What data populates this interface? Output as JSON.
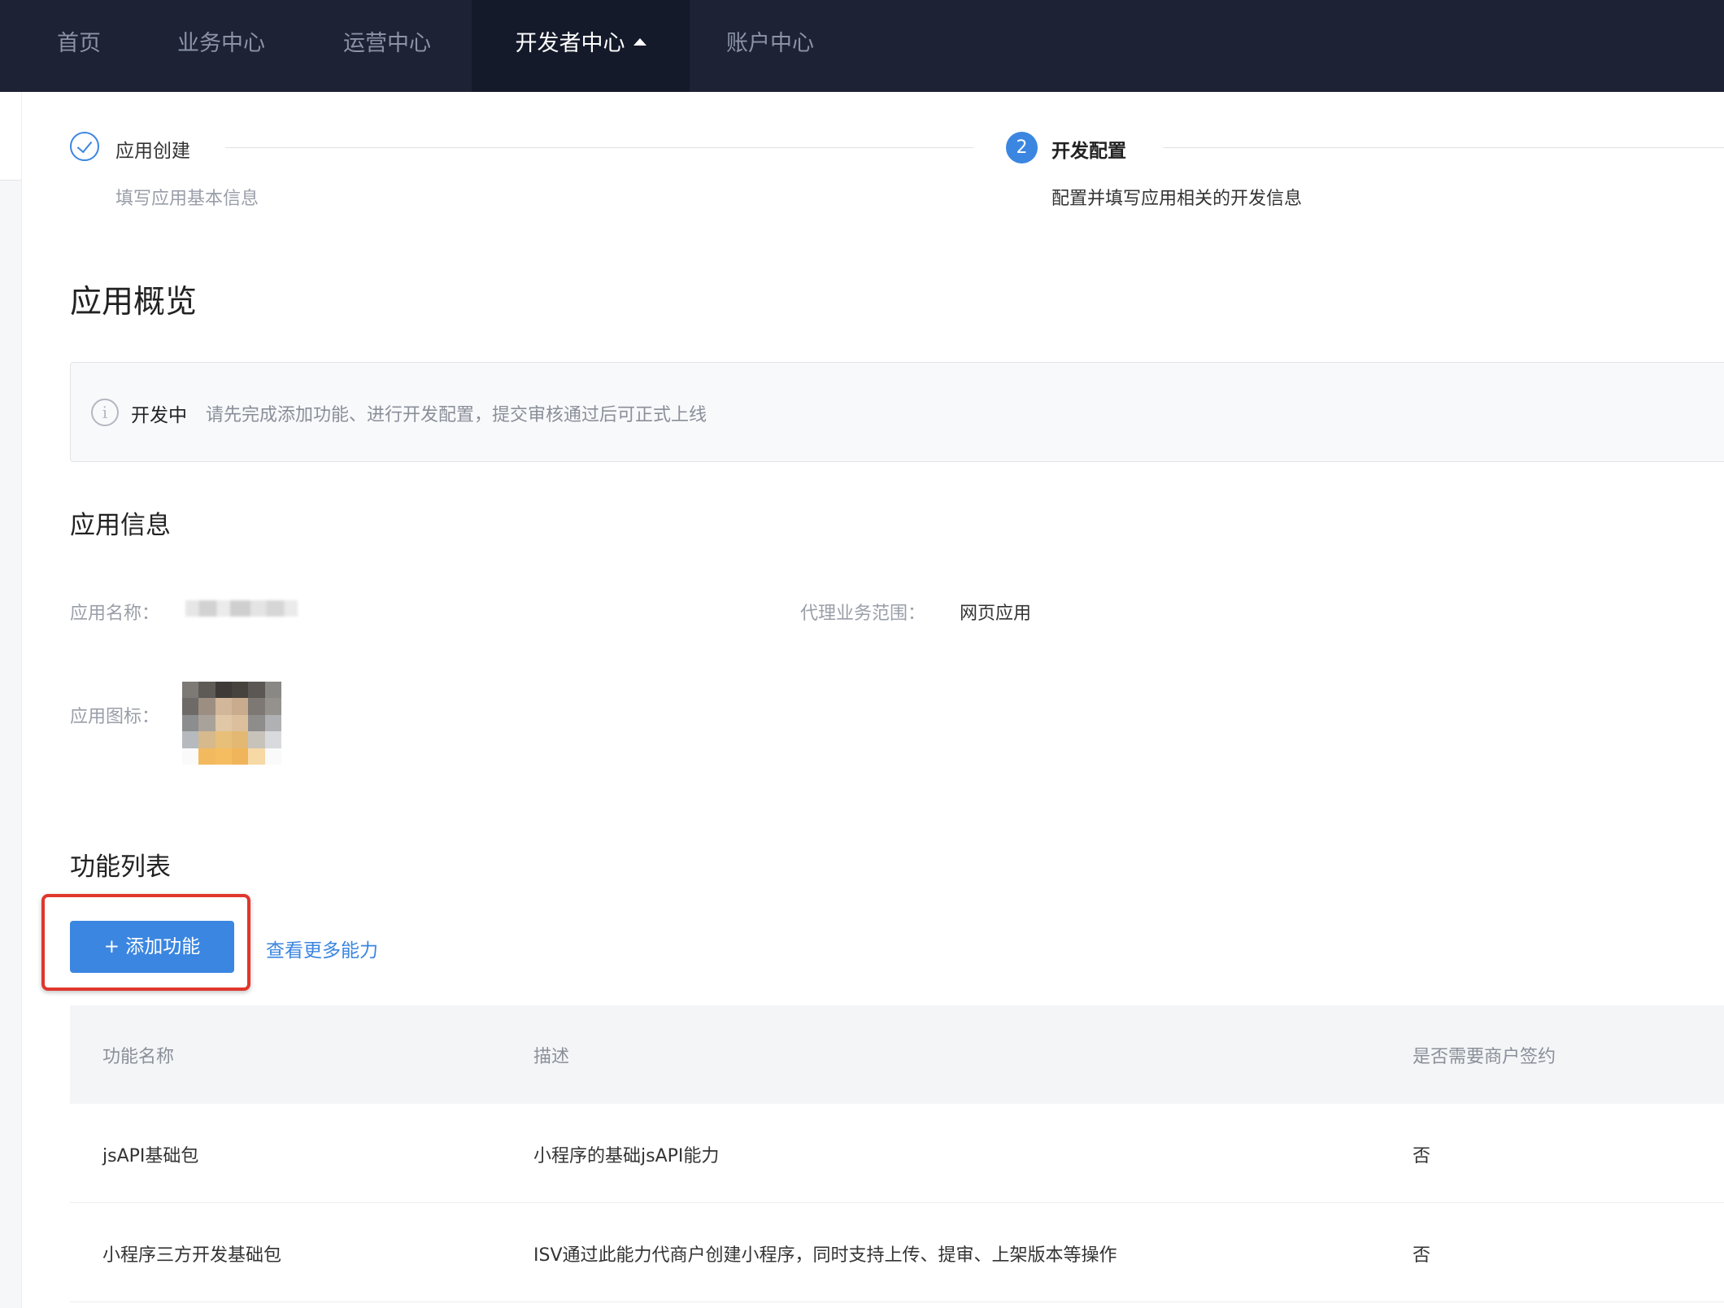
{
  "nav": {
    "items": [
      {
        "label": "首页"
      },
      {
        "label": "业务中心"
      },
      {
        "label": "运营中心"
      },
      {
        "label": "开发者中心"
      },
      {
        "label": "账户中心"
      }
    ],
    "active_index": 3
  },
  "steps": [
    {
      "title": "应用创建",
      "description": "填写应用基本信息",
      "status": "finished"
    },
    {
      "number": "2",
      "title": "开发配置",
      "description": "配置并填写应用相关的开发信息",
      "status": "active"
    }
  ],
  "overview": {
    "title": "应用概览",
    "alert": {
      "status": "开发中",
      "message": "请先完成添加功能、进行开发配置，提交审核通过后可正式上线",
      "icon": "info-icon"
    }
  },
  "app_info": {
    "title": "应用信息",
    "name_label": "应用名称：",
    "scope_label": "代理业务范围：",
    "scope_value": "网页应用",
    "icon_label": "应用图标："
  },
  "features": {
    "title": "功能列表",
    "add_button": "+ 添加功能",
    "more_link": "查看更多能力",
    "columns": [
      "功能名称",
      "描述",
      "是否需要商户签约"
    ],
    "rows": [
      [
        "jsAPI基础包",
        "小程序的基础jsAPI能力",
        "否"
      ],
      [
        "小程序三方开发基础包",
        "ISV通过此能力代商户创建小程序，同时支持上传、提审、上架版本等操作",
        "否"
      ]
    ]
  },
  "colors": {
    "nav_bg": "#1d2235",
    "accent": "#3b86e0",
    "highlight": "#e0362c"
  }
}
